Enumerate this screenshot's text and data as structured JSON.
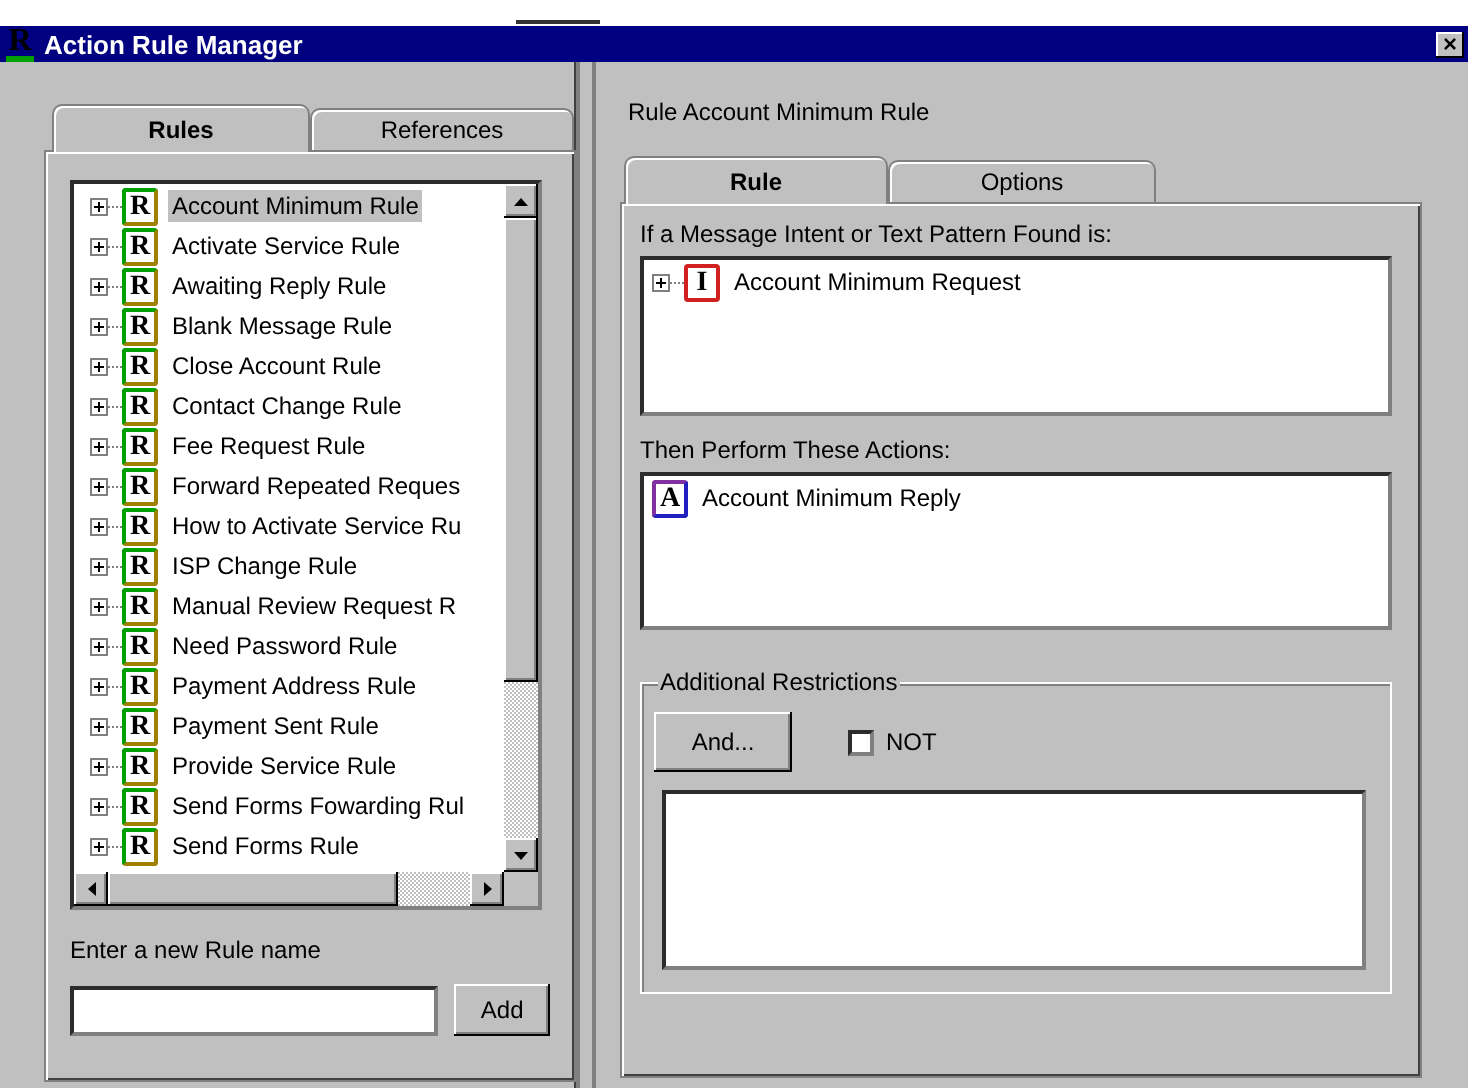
{
  "window": {
    "icon": "R",
    "title": "Action Rule Manager",
    "close": "×"
  },
  "left_tabs": [
    {
      "label": "Rules",
      "selected": true
    },
    {
      "label": "References",
      "selected": false
    }
  ],
  "rules": [
    {
      "badge": "R",
      "name": "Account Minimum Rule",
      "selected": true
    },
    {
      "badge": "R",
      "name": "Activate Service Rule",
      "selected": false
    },
    {
      "badge": "R",
      "name": "Awaiting Reply Rule",
      "selected": false
    },
    {
      "badge": "R",
      "name": "Blank Message Rule",
      "selected": false
    },
    {
      "badge": "R",
      "name": "Close Account Rule",
      "selected": false
    },
    {
      "badge": "R",
      "name": "Contact Change Rule",
      "selected": false
    },
    {
      "badge": "R",
      "name": "Fee Request Rule",
      "selected": false
    },
    {
      "badge": "R",
      "name": "Forward Repeated Reques",
      "selected": false
    },
    {
      "badge": "R",
      "name": "How to Activate Service Ru",
      "selected": false
    },
    {
      "badge": "R",
      "name": "ISP Change Rule",
      "selected": false
    },
    {
      "badge": "R",
      "name": "Manual Review Request R",
      "selected": false
    },
    {
      "badge": "R",
      "name": "Need Password Rule",
      "selected": false
    },
    {
      "badge": "R",
      "name": "Payment Address Rule",
      "selected": false
    },
    {
      "badge": "R",
      "name": "Payment Sent Rule",
      "selected": false
    },
    {
      "badge": "R",
      "name": "Provide Service Rule",
      "selected": false
    },
    {
      "badge": "R",
      "name": "Send Forms Fowarding Rul",
      "selected": false
    },
    {
      "badge": "R",
      "name": "Send Forms Rule",
      "selected": false
    }
  ],
  "new_rule": {
    "label": "Enter a new Rule name",
    "button": "Add"
  },
  "rule_heading": "Rule Account Minimum Rule",
  "right_tabs": [
    {
      "label": "Rule",
      "selected": true
    },
    {
      "label": "Options",
      "selected": false
    }
  ],
  "conditions": {
    "label": "If a Message Intent or Text Pattern Found is:",
    "items": [
      {
        "badge": "I",
        "name": "Account Minimum Request"
      }
    ]
  },
  "actions": {
    "label": "Then Perform These Actions:",
    "items": [
      {
        "badge": "A",
        "name": "Account Minimum Reply"
      }
    ]
  },
  "restrictions": {
    "title": "Additional Restrictions",
    "button": "And...",
    "not": {
      "label": "NOT",
      "checked": false
    }
  }
}
